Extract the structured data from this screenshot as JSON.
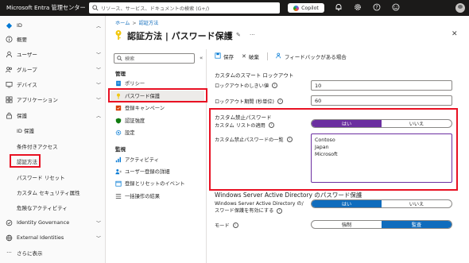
{
  "topbar": {
    "brand": "Microsoft Entra 管理センター",
    "search_placeholder": "リソース、サービス、ドキュメントの検索 (G+/)",
    "copilot": "Copilot"
  },
  "leftnav": {
    "items": [
      {
        "label": "ID"
      },
      {
        "label": "概要"
      },
      {
        "label": "ユーザー"
      },
      {
        "label": "グループ"
      },
      {
        "label": "デバイス"
      },
      {
        "label": "アプリケーション"
      },
      {
        "label": "保護"
      },
      {
        "label": "ID 保護"
      },
      {
        "label": "条件付きアクセス"
      },
      {
        "label": "認証方法"
      },
      {
        "label": "パスワード リセット"
      },
      {
        "label": "カスタム セキュリティ属性"
      },
      {
        "label": "危険なアクティビティ"
      },
      {
        "label": "Identity Governance"
      },
      {
        "label": "External Identities"
      },
      {
        "label": "さらに表示"
      }
    ]
  },
  "breadcrumb": {
    "home": "ホーム",
    "current": "認証方法"
  },
  "page": {
    "title": "認証方法 | パスワード保護"
  },
  "innernav": {
    "search_placeholder": "検索",
    "manage_header": "管理",
    "monitor_header": "監視",
    "manage_items": [
      {
        "label": "ポリシー"
      },
      {
        "label": "パスワード保護"
      },
      {
        "label": "登録キャンペーン"
      },
      {
        "label": "認証強度"
      },
      {
        "label": "設定"
      }
    ],
    "monitor_items": [
      {
        "label": "アクティビティ"
      },
      {
        "label": "ユーザー登録の詳細"
      },
      {
        "label": "登録とリセットのイベント"
      },
      {
        "label": "一括操作の結果"
      }
    ]
  },
  "toolbar": {
    "save": "保存",
    "discard": "破棄",
    "feedback": "フィードバックがある場合"
  },
  "form": {
    "smart_lockout_title": "カスタムのスマート ロックアウト",
    "lockout_threshold_label": "ロックアウトのしきい値",
    "lockout_threshold_value": "10",
    "lockout_duration_label": "ロックアウト期間 (秒単位)",
    "lockout_duration_value": "60",
    "banned_title": "カスタム禁止パスワード",
    "enforce_label": "カスタム リストの適用",
    "enforce_yes": "はい",
    "enforce_no": "いいえ",
    "banned_list_label": "カスタム禁止パスワードの一覧",
    "banned_list": [
      "Contoso",
      "Japan",
      "Microsoft"
    ],
    "wsad_title": "Windows Server Active Directory のパスワード保護",
    "wsad_enable_label_1": "Windows Server Active Directory の/",
    "wsad_enable_label_2": "スワード保護を有効にする",
    "wsad_yes": "はい",
    "wsad_no": "いいえ",
    "mode_label": "モード",
    "mode_enforced": "強制",
    "mode_audit": "監査"
  }
}
